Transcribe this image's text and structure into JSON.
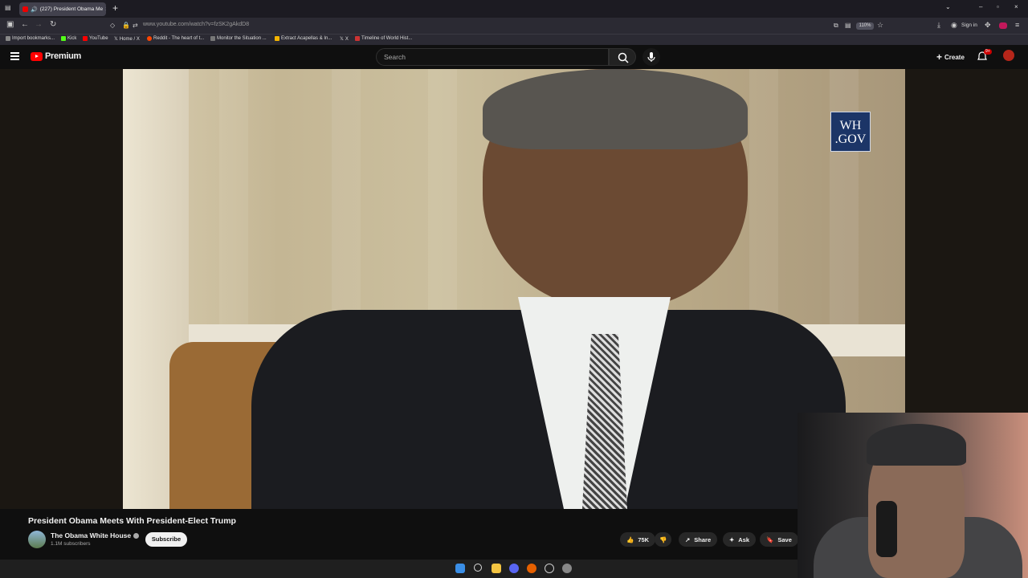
{
  "browser": {
    "tab_title": "(227) President Obama Me",
    "tab_close": "×",
    "new_tab": "+",
    "url": "www.youtube.com/watch?v=fzSK2gAkdD8",
    "zoom": "110%",
    "sign_in": "Sign in",
    "window_controls": [
      "–",
      "▫",
      "×"
    ],
    "bookmarks": [
      {
        "label": "Import bookmarks...",
        "color": "#888888"
      },
      {
        "label": "Kick",
        "color": "#53fc18"
      },
      {
        "label": "YouTube",
        "color": "#ff0000"
      },
      {
        "label": "Home / X",
        "color": "#ffffff"
      },
      {
        "label": "Reddit - The heart of t...",
        "color": "#ff4500"
      },
      {
        "label": "Monitor the Situation ...",
        "color": "#777777"
      },
      {
        "label": "Extract Acapellas & In...",
        "color": "#f4b400"
      },
      {
        "label": "X",
        "color": "#ffffff"
      },
      {
        "label": "Timeline of World Hist...",
        "color": "#cc3333"
      }
    ]
  },
  "youtube": {
    "brand": "Premium",
    "search_placeholder": "Search",
    "create_label": "Create",
    "notification_badge": "9+"
  },
  "video": {
    "watermark_line1": "WH",
    "watermark_line2": ".GOV",
    "title": "President Obama Meets With President-Elect Trump",
    "channel": "The Obama White House",
    "subscribers": "1.1M subscribers",
    "subscribe_label": "Subscribe",
    "likes": "75K",
    "share_label": "Share",
    "ask_label": "Ask",
    "save_label": "Save"
  },
  "colors": {
    "accent": "#ff0000",
    "background": "#0f0f0f"
  }
}
